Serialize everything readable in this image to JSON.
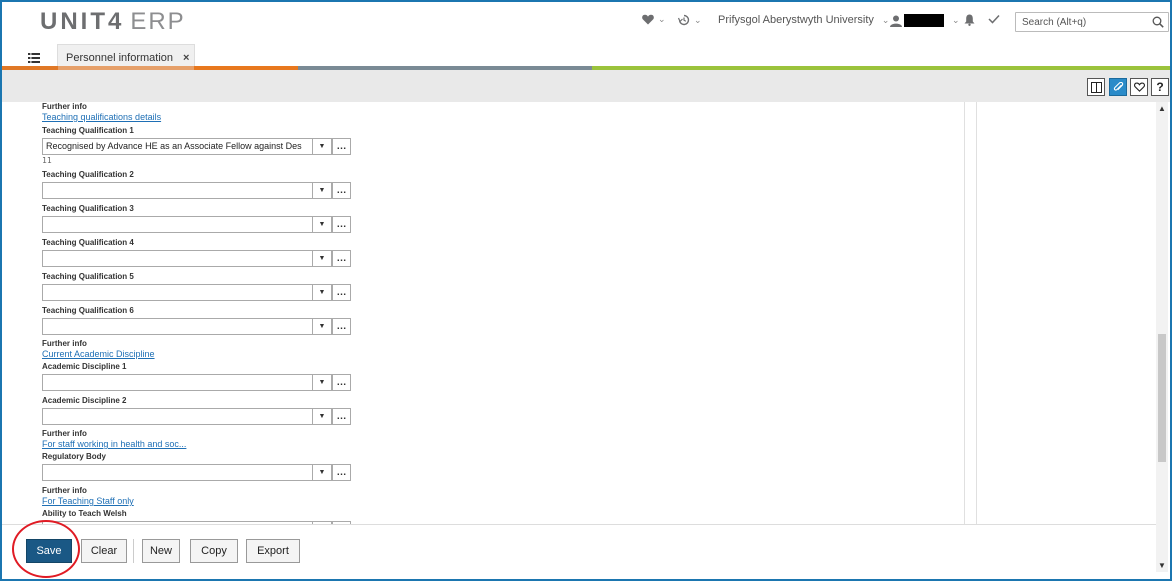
{
  "header": {
    "logo_brand": "UNIT4",
    "logo_product": "ERP",
    "company": "Prifysgol Aberystwyth University",
    "search_placeholder": "Search (Alt+q)"
  },
  "tabs": [
    {
      "label": "Personnel information"
    }
  ],
  "form": {
    "sections": [
      {
        "further_label": "Further info",
        "link": "Teaching qualifications details"
      },
      {
        "further_label": "Further info",
        "link": "Current Academic Discipline"
      },
      {
        "further_label": "Further info",
        "link": "For staff working in health and soc..."
      },
      {
        "further_label": "Further info",
        "link": "For Teaching Staff only"
      }
    ],
    "fields": [
      {
        "label": "Teaching Qualification 1",
        "value": "Recognised by Advance HE as an Associate Fellow against Des",
        "sub": "11"
      },
      {
        "label": "Teaching Qualification 2",
        "value": ""
      },
      {
        "label": "Teaching Qualification 3",
        "value": ""
      },
      {
        "label": "Teaching Qualification 4",
        "value": ""
      },
      {
        "label": "Teaching Qualification 5",
        "value": ""
      },
      {
        "label": "Teaching Qualification 6",
        "value": ""
      },
      {
        "label": "Academic Discipline 1",
        "value": ""
      },
      {
        "label": "Academic Discipline 2",
        "value": ""
      },
      {
        "label": "Regulatory Body",
        "value": ""
      },
      {
        "label": "Ability to Teach Welsh",
        "value": ""
      }
    ]
  },
  "buttons": {
    "save": "Save",
    "clear": "Clear",
    "new": "New",
    "copy": "Copy",
    "export": "Export"
  },
  "colors": {
    "accent_blue": "#1b76b0",
    "save_button": "#1a5885",
    "link": "#1e6fb5",
    "highlight_circle": "#e01b24"
  }
}
